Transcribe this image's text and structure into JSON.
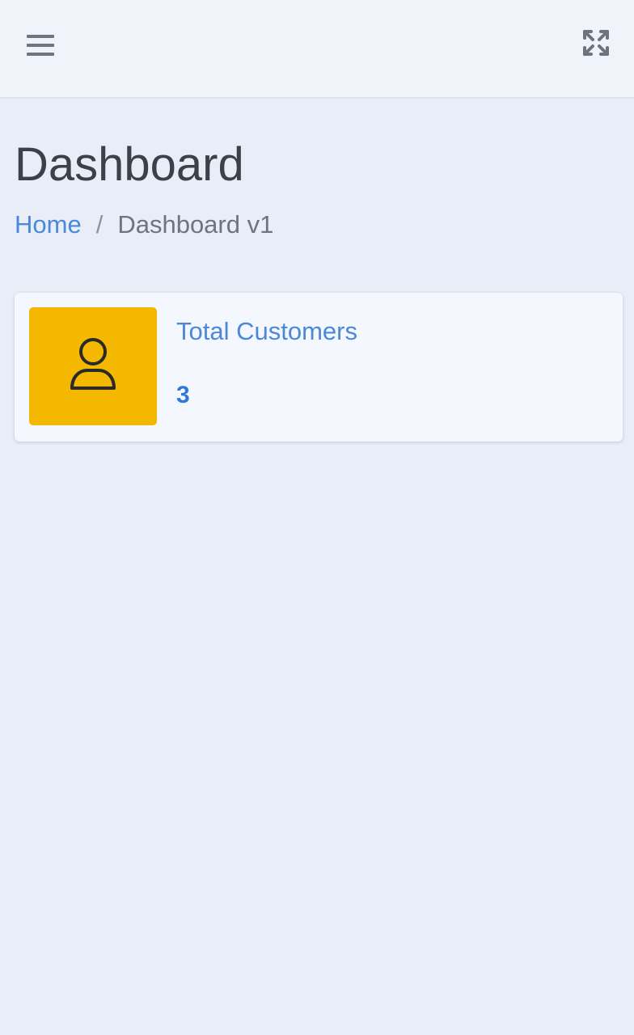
{
  "navbar": {
    "menu_icon": "hamburger-menu-icon",
    "fullscreen_icon": "expand-arrows-icon"
  },
  "header": {
    "title": "Dashboard",
    "breadcrumb": {
      "home": "Home",
      "separator": "/",
      "current": "Dashboard v1"
    }
  },
  "stats": {
    "total_customers": {
      "label": "Total Customers",
      "value": "3",
      "icon": "user-icon",
      "icon_bg": "#f4b800"
    }
  },
  "colors": {
    "link": "#4a89d8",
    "value": "#2e7bd4",
    "background": "#e9edf8"
  }
}
